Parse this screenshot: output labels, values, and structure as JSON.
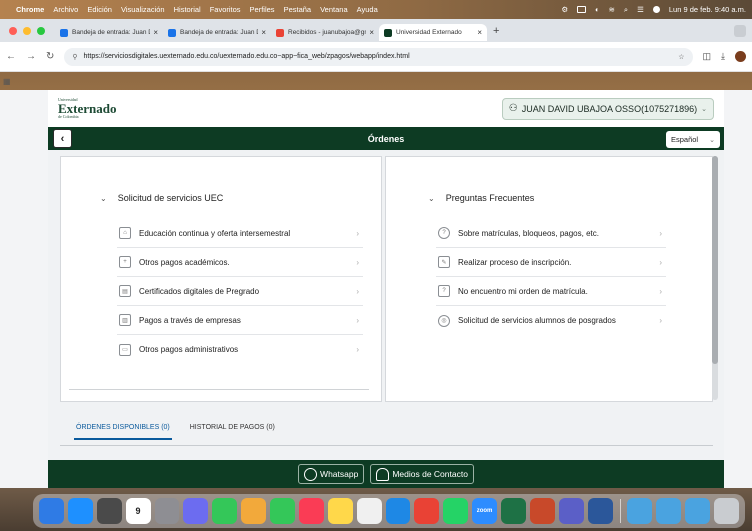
{
  "menubar": {
    "app": "Chrome",
    "items": [
      "Archivo",
      "Edición",
      "Visualización",
      "Historial",
      "Favoritos",
      "Perfiles",
      "Pestaña",
      "Ventana",
      "Ayuda"
    ],
    "clock": "Lun 9 de feb. 9:40 a.m."
  },
  "browser": {
    "tabs": [
      {
        "label": "Bandeja de entrada: Juan Davi",
        "favicon_color": "#1a73e8"
      },
      {
        "label": "Bandeja de entrada: Juan Davi",
        "favicon_color": "#1a73e8"
      },
      {
        "label": "Recibidos - juanubajoa@gmail",
        "favicon_color": "#ea4335"
      },
      {
        "label": "Universidad Externado",
        "favicon_color": "#0d3b23"
      }
    ],
    "new_tab": "+",
    "url": "https://serviciosdigitales.uexternado.edu.co/uexternado.edu.co~app~fica_web/zpagos/webapp/index.html"
  },
  "header": {
    "logo_small": "Universidad",
    "logo_big": "Externado",
    "logo_sub": "de Colombia",
    "user": "JUAN DAVID UBAJOA OSSO(1075271896)"
  },
  "titlebar": {
    "title": "Órdenes",
    "language": "Español"
  },
  "left_panel": {
    "title": "Solicitud de servicios UEC",
    "items": [
      {
        "label": "Educación continua y oferta intersemestral"
      },
      {
        "label": "Otros pagos académicos."
      },
      {
        "label": "Certificados digitales de Pregrado"
      },
      {
        "label": "Pagos a través de empresas"
      },
      {
        "label": "Otros pagos administrativos"
      }
    ]
  },
  "right_panel": {
    "title": "Preguntas Frecuentes",
    "items": [
      {
        "label": "Sobre matrículas, bloqueos, pagos, etc."
      },
      {
        "label": "Realizar proceso de inscripción."
      },
      {
        "label": "No encuentro mi orden de matrícula."
      },
      {
        "label": "Solicitud de servicios alumnos de posgrados"
      }
    ]
  },
  "bottom_tabs": [
    {
      "label": "ÓRDENES DISPONIBLES (0)"
    },
    {
      "label": "HISTORIAL DE PAGOS (0)"
    }
  ],
  "footer": {
    "whatsapp": "Whatsapp",
    "contact": "Medios de Contacto"
  },
  "dock": {
    "calendar_day": "9",
    "icons": [
      {
        "name": "finder",
        "color": "#2f7be5"
      },
      {
        "name": "app-store",
        "color": "#1e90ff"
      },
      {
        "name": "calculator",
        "color": "#4a4a4a"
      },
      {
        "name": "calendar",
        "color": "#ffffff"
      },
      {
        "name": "system-settings",
        "color": "#8e8e93"
      },
      {
        "name": "contacts",
        "color": "#6c6cf0"
      },
      {
        "name": "facetime",
        "color": "#34c759"
      },
      {
        "name": "photos",
        "color": "#f2a93b"
      },
      {
        "name": "messages",
        "color": "#34c759"
      },
      {
        "name": "music",
        "color": "#fa3c55"
      },
      {
        "name": "notes",
        "color": "#ffd84a"
      },
      {
        "name": "reminders",
        "color": "#f0f0f0"
      },
      {
        "name": "safari",
        "color": "#1e88e5"
      },
      {
        "name": "chrome",
        "color": "#e94235"
      },
      {
        "name": "whatsapp",
        "color": "#25d366"
      },
      {
        "name": "zoom",
        "color": "#2d8cff"
      },
      {
        "name": "excel",
        "color": "#1e7145"
      },
      {
        "name": "powerpoint",
        "color": "#c8492a"
      },
      {
        "name": "teams",
        "color": "#5b5fc7"
      },
      {
        "name": "word",
        "color": "#2b579a"
      }
    ],
    "zoom_label": "zoom"
  }
}
